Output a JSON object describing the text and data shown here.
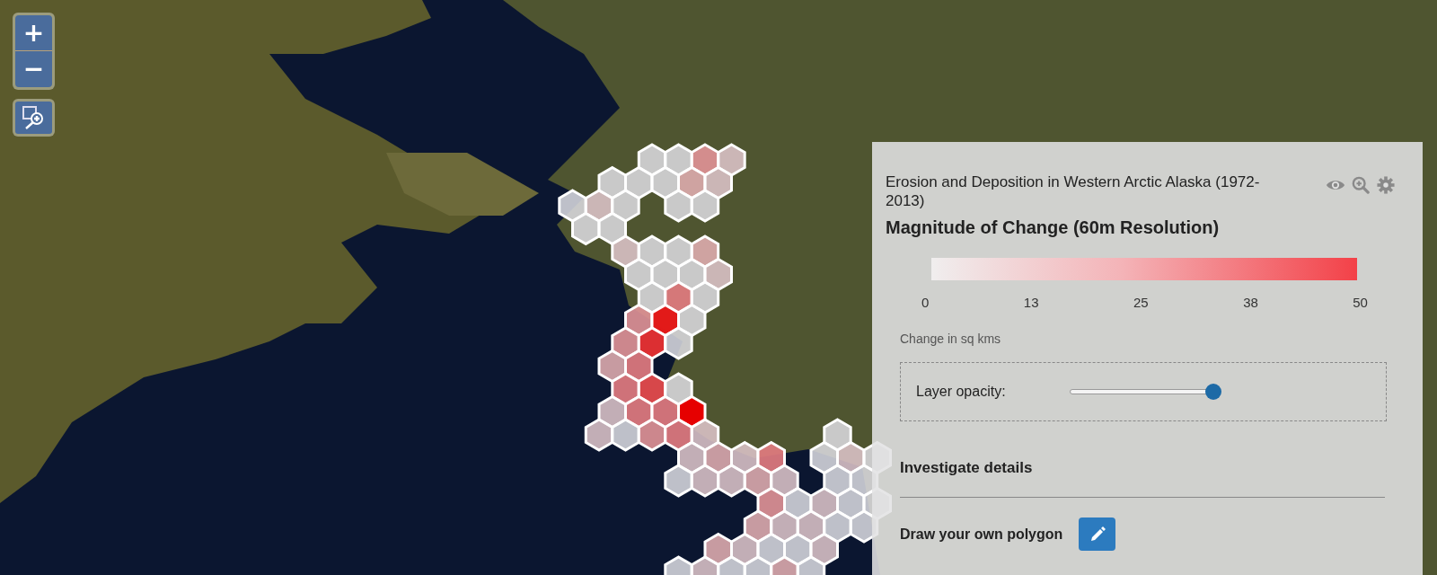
{
  "map_controls": {
    "zoom_in": "+",
    "zoom_out": "−"
  },
  "panel": {
    "title": "Erosion and Deposition in Western Arctic Alaska (1972-2013)",
    "legend": {
      "title": "Magnitude of Change (60m Resolution)",
      "ticks": [
        "0",
        "13",
        "25",
        "38",
        "50"
      ],
      "unit_label": "Change in sq kms"
    },
    "opacity": {
      "label": "Layer opacity:",
      "level": 0.97
    },
    "investigate": {
      "label": "Investigate details"
    },
    "draw": {
      "label": "Draw your own polygon"
    }
  }
}
